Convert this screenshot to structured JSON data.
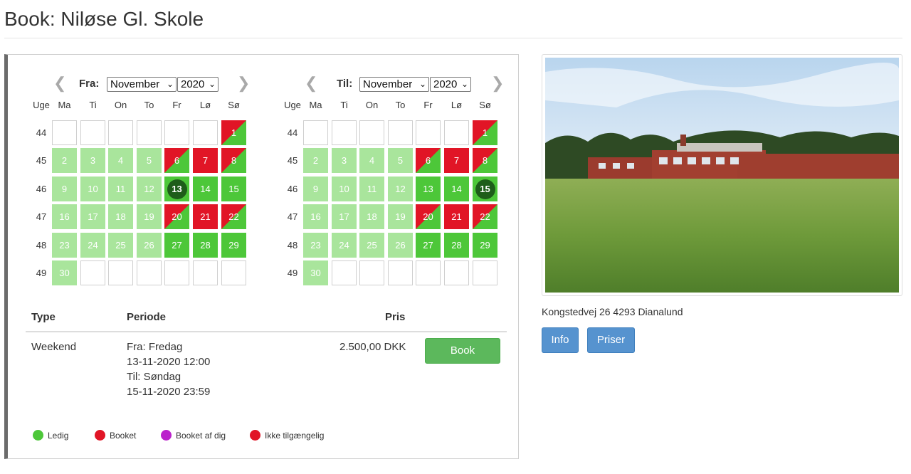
{
  "page": {
    "title": "Book: Niløse Gl. Skole"
  },
  "weekday_headers": [
    "Uge",
    "Ma",
    "Ti",
    "On",
    "To",
    "Fr",
    "Lø",
    "Sø"
  ],
  "calendars": [
    {
      "label": "Fra:",
      "month": "November",
      "year": "2020",
      "selected_day": "13",
      "weeks": [
        {
          "week": "44",
          "days": [
            [
              "",
              "empty"
            ],
            [
              "",
              "empty"
            ],
            [
              "",
              "empty"
            ],
            [
              "",
              "empty"
            ],
            [
              "",
              "empty"
            ],
            [
              "",
              "empty"
            ],
            [
              "1",
              "diag"
            ]
          ]
        },
        {
          "week": "45",
          "days": [
            [
              "2",
              "light"
            ],
            [
              "3",
              "light"
            ],
            [
              "4",
              "light"
            ],
            [
              "5",
              "light"
            ],
            [
              "6",
              "diag"
            ],
            [
              "7",
              "red"
            ],
            [
              "8",
              "diag"
            ]
          ]
        },
        {
          "week": "46",
          "days": [
            [
              "9",
              "light"
            ],
            [
              "10",
              "light"
            ],
            [
              "11",
              "light"
            ],
            [
              "12",
              "light"
            ],
            [
              "13",
              "selected"
            ],
            [
              "14",
              "green"
            ],
            [
              "15",
              "green"
            ]
          ]
        },
        {
          "week": "47",
          "days": [
            [
              "16",
              "light"
            ],
            [
              "17",
              "light"
            ],
            [
              "18",
              "light"
            ],
            [
              "19",
              "light"
            ],
            [
              "20",
              "diag"
            ],
            [
              "21",
              "red"
            ],
            [
              "22",
              "diag"
            ]
          ]
        },
        {
          "week": "48",
          "days": [
            [
              "23",
              "light"
            ],
            [
              "24",
              "light"
            ],
            [
              "25",
              "light"
            ],
            [
              "26",
              "light"
            ],
            [
              "27",
              "green"
            ],
            [
              "28",
              "green"
            ],
            [
              "29",
              "green"
            ]
          ]
        },
        {
          "week": "49",
          "days": [
            [
              "30",
              "light"
            ],
            [
              "",
              "empty"
            ],
            [
              "",
              "empty"
            ],
            [
              "",
              "empty"
            ],
            [
              "",
              "empty"
            ],
            [
              "",
              "empty"
            ],
            [
              "",
              "empty"
            ]
          ]
        }
      ]
    },
    {
      "label": "Til:",
      "month": "November",
      "year": "2020",
      "selected_day": "15",
      "weeks": [
        {
          "week": "44",
          "days": [
            [
              "",
              "empty"
            ],
            [
              "",
              "empty"
            ],
            [
              "",
              "empty"
            ],
            [
              "",
              "empty"
            ],
            [
              "",
              "empty"
            ],
            [
              "",
              "empty"
            ],
            [
              "1",
              "diag"
            ]
          ]
        },
        {
          "week": "45",
          "days": [
            [
              "2",
              "light"
            ],
            [
              "3",
              "light"
            ],
            [
              "4",
              "light"
            ],
            [
              "5",
              "light"
            ],
            [
              "6",
              "diag"
            ],
            [
              "7",
              "red"
            ],
            [
              "8",
              "diag"
            ]
          ]
        },
        {
          "week": "46",
          "days": [
            [
              "9",
              "light"
            ],
            [
              "10",
              "light"
            ],
            [
              "11",
              "light"
            ],
            [
              "12",
              "light"
            ],
            [
              "13",
              "green"
            ],
            [
              "14",
              "green"
            ],
            [
              "15",
              "selected"
            ]
          ]
        },
        {
          "week": "47",
          "days": [
            [
              "16",
              "light"
            ],
            [
              "17",
              "light"
            ],
            [
              "18",
              "light"
            ],
            [
              "19",
              "light"
            ],
            [
              "20",
              "diag"
            ],
            [
              "21",
              "red"
            ],
            [
              "22",
              "diag"
            ]
          ]
        },
        {
          "week": "48",
          "days": [
            [
              "23",
              "light"
            ],
            [
              "24",
              "light"
            ],
            [
              "25",
              "light"
            ],
            [
              "26",
              "light"
            ],
            [
              "27",
              "green"
            ],
            [
              "28",
              "green"
            ],
            [
              "29",
              "green"
            ]
          ]
        },
        {
          "week": "49",
          "days": [
            [
              "30",
              "light"
            ],
            [
              "",
              "empty"
            ],
            [
              "",
              "empty"
            ],
            [
              "",
              "empty"
            ],
            [
              "",
              "empty"
            ],
            [
              "",
              "empty"
            ],
            [
              "",
              "empty"
            ]
          ]
        }
      ]
    }
  ],
  "table": {
    "headers": {
      "type": "Type",
      "period": "Periode",
      "price": "Pris"
    },
    "row": {
      "type": "Weekend",
      "period_lines": [
        "Fra: Fredag",
        "13-11-2020 12:00",
        "Til: Søndag",
        "15-11-2020 23:59"
      ],
      "price": "2.500,00 DKK",
      "book_label": "Book"
    }
  },
  "legend": [
    {
      "label": "Ledig",
      "color": "#4dc739"
    },
    {
      "label": "Booket",
      "color": "#e11526"
    },
    {
      "label": "Booket af dig",
      "color": "#bb22cc"
    },
    {
      "label": "Ikke tilgængelig",
      "color": "#e11526"
    }
  ],
  "colors": {
    "available": "#4dc739",
    "available_light": "#a9e59c",
    "booked": "#e11526",
    "selected": "#1e5d1a",
    "primary_button": "#5693cf",
    "success_button": "#5cb85c"
  },
  "venue": {
    "address": "Kongstedvej 26 4293 Dianalund",
    "info_label": "Info",
    "prices_label": "Priser"
  },
  "icons": {
    "prev": "chevron-left-icon",
    "next": "chevron-right-icon",
    "select": "chevron-down-icon"
  }
}
